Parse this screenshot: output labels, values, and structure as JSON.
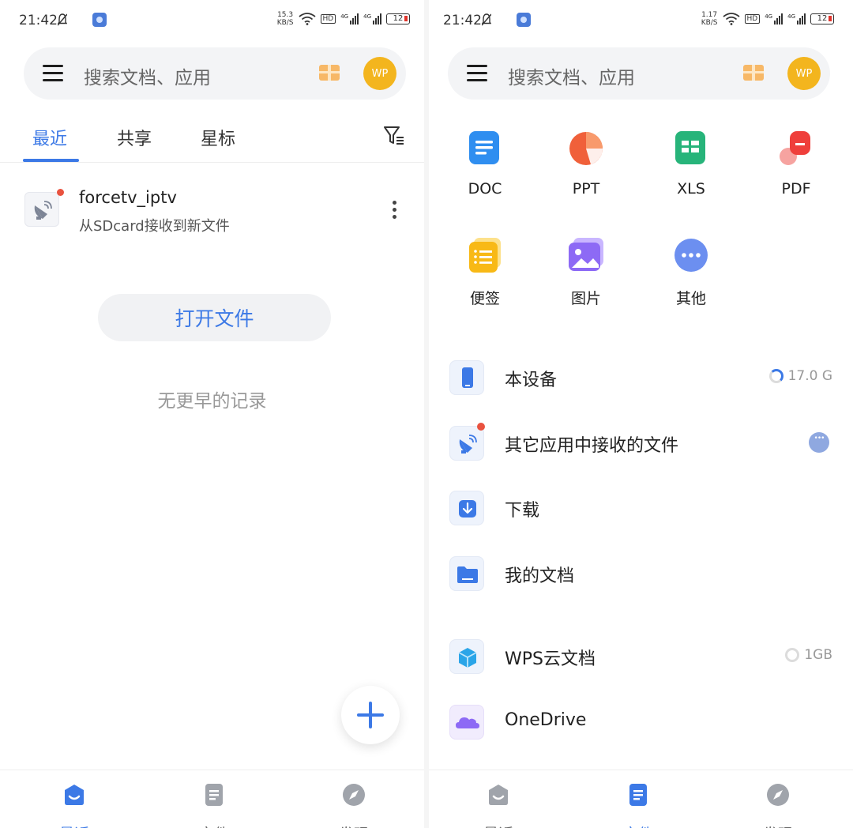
{
  "colors": {
    "accent": "#3c79e6",
    "avatar": "#f3b51e",
    "badge": "#e9523f"
  },
  "left": {
    "status": {
      "time": "21:42",
      "speed_top": "15.3",
      "speed_unit": "KB/S",
      "hd": "HD",
      "net1": "4G",
      "net2": "4G",
      "battery": "12"
    },
    "search": {
      "placeholder": "搜索文档、应用",
      "avatar": "WP"
    },
    "tabs": [
      {
        "label": "最近",
        "active": true
      },
      {
        "label": "共享"
      },
      {
        "label": "星标"
      }
    ],
    "recent": {
      "title": "forcetv_iptv",
      "subtitle": "从SDcard接收到新文件"
    },
    "open_button": "打开文件",
    "empty_text": "无更早的记录",
    "nav": [
      {
        "label": "最近",
        "icon": "recent-icon",
        "active": true
      },
      {
        "label": "文件",
        "icon": "file-icon"
      },
      {
        "label": "发现",
        "icon": "compass-icon"
      }
    ]
  },
  "right": {
    "status": {
      "time": "21:42",
      "speed_top": "1.17",
      "speed_unit": "KB/S",
      "hd": "HD",
      "net1": "4G",
      "net2": "4G",
      "battery": "12"
    },
    "search": {
      "placeholder": "搜索文档、应用",
      "avatar": "WP"
    },
    "types": [
      {
        "label": "DOC",
        "icon": "doc-icon"
      },
      {
        "label": "PPT",
        "icon": "ppt-icon"
      },
      {
        "label": "XLS",
        "icon": "xls-icon"
      },
      {
        "label": "PDF",
        "icon": "pdf-icon"
      },
      {
        "label": "便签",
        "icon": "note-icon"
      },
      {
        "label": "图片",
        "icon": "image-icon"
      },
      {
        "label": "其他",
        "icon": "other-icon"
      }
    ],
    "locations": [
      {
        "label": "本设备",
        "extra": "17.0 G",
        "icon": "phone-icon"
      },
      {
        "label": "其它应用中接收的文件",
        "icon": "satellite-icon"
      },
      {
        "label": "下载",
        "icon": "download-icon"
      },
      {
        "label": "我的文档",
        "icon": "folder-icon"
      },
      {
        "label": "WPS云文档",
        "extra": "1GB",
        "icon": "cloud-box-icon"
      },
      {
        "label": "OneDrive",
        "icon": "onedrive-icon"
      }
    ],
    "nav": [
      {
        "label": "最近",
        "icon": "recent-icon"
      },
      {
        "label": "文件",
        "icon": "file-icon",
        "active": true
      },
      {
        "label": "发现",
        "icon": "compass-icon"
      }
    ]
  }
}
